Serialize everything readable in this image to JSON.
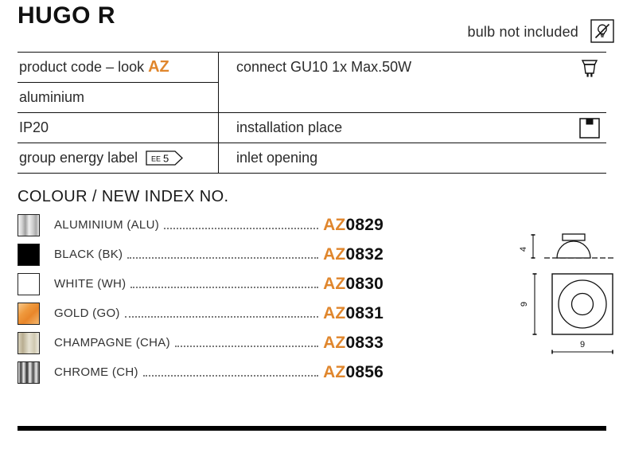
{
  "header": {
    "product_title": "HUGO R",
    "bulb_note": "bulb not included",
    "no_bulb_icon": "no-bulb-icon"
  },
  "spec_table": {
    "rows": [
      {
        "left_lines": [
          "product code – look AZ",
          "aluminium"
        ],
        "left_accent": "AZ",
        "left_plain": "product code – look ",
        "right": "connect GU10 1x Max.50W",
        "right_icon": "gu10-bulb-icon"
      },
      {
        "left": "IP20",
        "right": "installation place",
        "right_icon": "ceiling-mount-icon"
      },
      {
        "left": "group energy label",
        "badge_small": "EE",
        "badge_large": "5",
        "right": "inlet opening",
        "right_icon": ""
      }
    ]
  },
  "colours": {
    "heading": "COLOUR / NEW INDEX NO.",
    "accent_color": "#e0862c",
    "items": [
      {
        "name": "ALUMINIUM (ALU)",
        "prefix": "AZ",
        "number": "0829",
        "swatch": "aluminium-swatch"
      },
      {
        "name": "BLACK (BK)",
        "prefix": "AZ",
        "number": "0832",
        "swatch": "black-swatch"
      },
      {
        "name": "WHITE (WH)",
        "prefix": "AZ",
        "number": "0830",
        "swatch": "white-swatch"
      },
      {
        "name": "GOLD (GO)",
        "prefix": "AZ",
        "number": "0831",
        "swatch": "gold-swatch"
      },
      {
        "name": "CHAMPAGNE (CHA)",
        "prefix": "AZ",
        "number": "0833",
        "swatch": "champagne-swatch"
      },
      {
        "name": "CHROME (CH)",
        "prefix": "AZ",
        "number": "0856",
        "swatch": "chrome-swatch"
      }
    ]
  },
  "drawings": {
    "side_view_height": "4",
    "top_view_height": "9",
    "top_view_width": "9"
  }
}
